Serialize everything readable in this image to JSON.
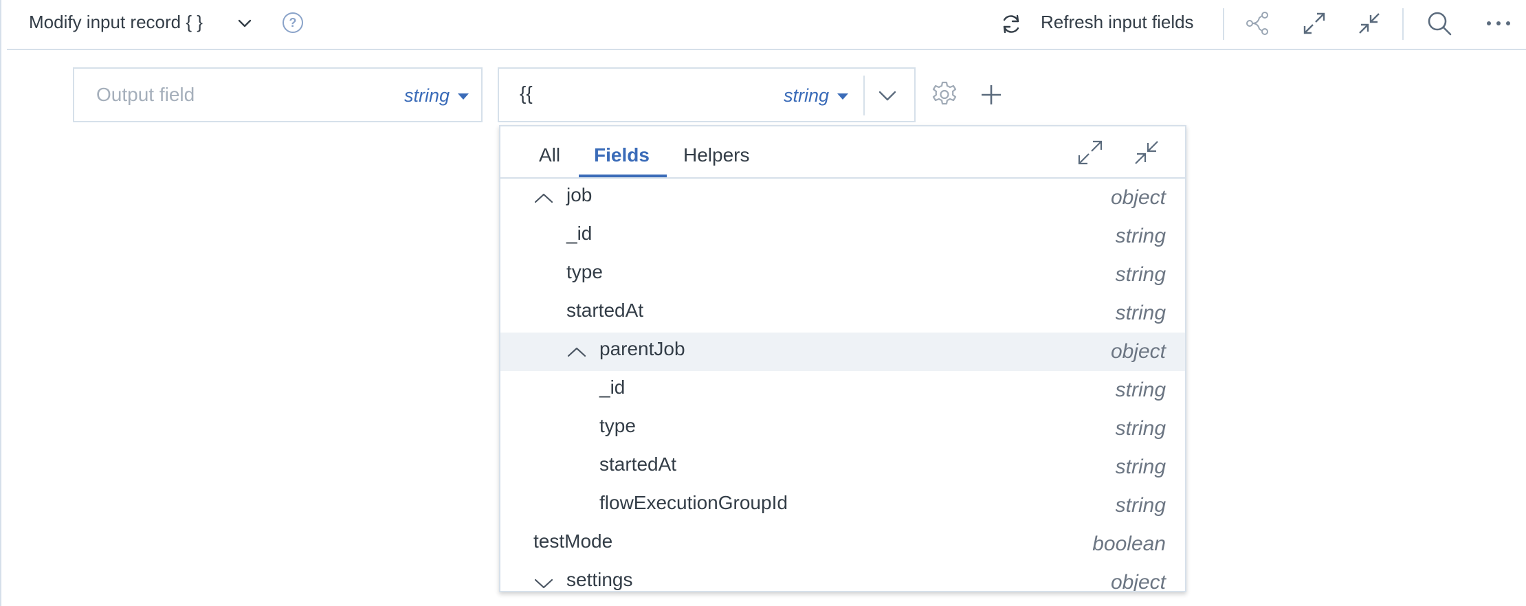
{
  "header": {
    "title": "Modify input record { }",
    "refresh_label": "Refresh input fields"
  },
  "icons": {
    "title_chevron": "chevron-down-icon",
    "help": "help-circle-icon",
    "refresh": "refresh-icon",
    "flow": "share-nodes-icon",
    "expand": "expand-icon",
    "collapse": "collapse-icon",
    "search": "search-icon",
    "more": "more-icon",
    "gear": "gear-icon",
    "add": "plus-icon"
  },
  "help_glyph": "?",
  "output_field": {
    "placeholder": "Output field",
    "value": "",
    "type": "string"
  },
  "expression_field": {
    "value": "{{",
    "type": "string"
  },
  "dropdown": {
    "tabs": [
      {
        "label": "All",
        "active": false
      },
      {
        "label": "Fields",
        "active": true
      },
      {
        "label": "Helpers",
        "active": false
      }
    ],
    "rows": [
      {
        "name": "job",
        "type": "object",
        "level": 1,
        "chevron": "up"
      },
      {
        "name": "_id",
        "type": "string",
        "level": 1
      },
      {
        "name": "type",
        "type": "string",
        "level": 1
      },
      {
        "name": "startedAt",
        "type": "string",
        "level": 1
      },
      {
        "name": "parentJob",
        "type": "object",
        "level": 2,
        "chevron": "up",
        "highlight": true
      },
      {
        "name": "_id",
        "type": "string",
        "level": 2
      },
      {
        "name": "type",
        "type": "string",
        "level": 2
      },
      {
        "name": "startedAt",
        "type": "string",
        "level": 2
      },
      {
        "name": "flowExecutionGroupId",
        "type": "string",
        "level": 2
      },
      {
        "name": "testMode",
        "type": "boolean",
        "level": 0
      },
      {
        "name": "settings",
        "type": "object",
        "level": 1,
        "chevron": "down"
      }
    ]
  },
  "colors": {
    "accent": "#3a6bb8",
    "text": "#333d47",
    "muted": "#6c7683",
    "border": "#d6e0ea",
    "highlight": "#eef2f6",
    "icon": "#5b6b7d"
  }
}
